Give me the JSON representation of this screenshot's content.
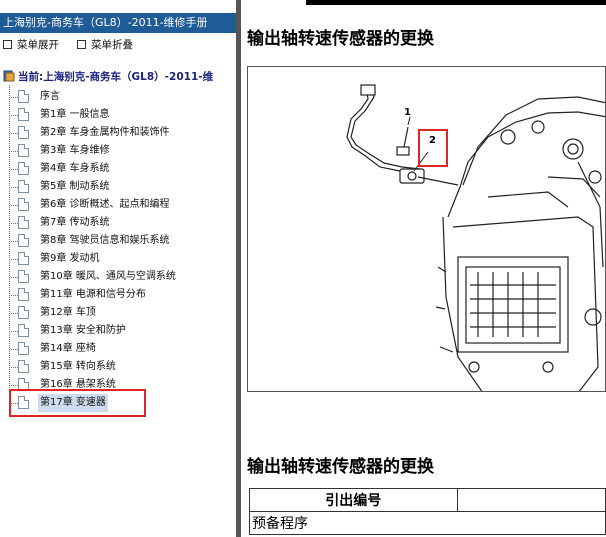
{
  "left_pane": {
    "title": "上海别克-商务车（GL8）-2011-维修手册",
    "toolbar": {
      "expand_label": "菜单展开",
      "collapse_label": "菜单折叠"
    },
    "tree_root": "当前:上海别克-商务车（GL8）-2011-维",
    "items": [
      {
        "label": "序言"
      },
      {
        "label": "第1章 一般信息"
      },
      {
        "label": "第2章 车身金属构件和装饰件"
      },
      {
        "label": "第3章 车身维修"
      },
      {
        "label": "第4章 车身系统"
      },
      {
        "label": "第5章 制动系统"
      },
      {
        "label": "第6章 诊断概述、起点和编程"
      },
      {
        "label": "第7章 传动系统"
      },
      {
        "label": "第8章 驾驶员信息和娱乐系统"
      },
      {
        "label": "第9章 发动机"
      },
      {
        "label": "第10章 暖风、通风与空调系统"
      },
      {
        "label": "第11章 电源和信号分布"
      },
      {
        "label": "第12章 车顶"
      },
      {
        "label": "第13章 安全和防护"
      },
      {
        "label": "第14章 座椅"
      },
      {
        "label": "第15章 转向系统"
      },
      {
        "label": "第16章 悬架系统"
      },
      {
        "label": "第17章 变速器",
        "selected": true
      }
    ]
  },
  "right_pane": {
    "heading_top": "输出轴转速传感器的更换",
    "figure": {
      "callout_1": "1",
      "callout_2": "2"
    },
    "heading_bottom": "输出轴转速传感器的更换",
    "table": {
      "header": "引出编号",
      "first_row": "预备程序"
    }
  },
  "colors": {
    "title_bar": "#1f5b96",
    "highlight": "#e02424",
    "splitter": "#555555"
  }
}
